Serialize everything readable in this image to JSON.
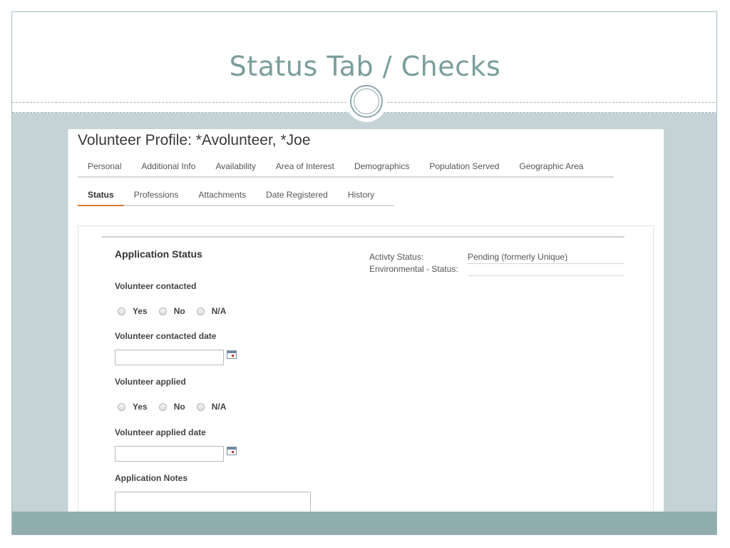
{
  "slide": {
    "title": "Status Tab / Checks"
  },
  "profile": {
    "title": "Volunteer Profile: *Avolunteer, *Joe"
  },
  "tabs_row1": [
    "Personal",
    "Additional Info",
    "Availability",
    "Area of Interest",
    "Demographics",
    "Population Served",
    "Geographic Area"
  ],
  "tabs_row2": [
    "Status",
    "Professions",
    "Attachments",
    "Date Registered",
    "History"
  ],
  "active_tab": "Status",
  "form": {
    "section_title": "Application Status",
    "volunteer_contacted_label": "Volunteer contacted",
    "contacted_options": [
      "Yes",
      "No",
      "N/A"
    ],
    "contacted_date_label": "Volunteer contacted date",
    "contacted_date_value": "",
    "volunteer_applied_label": "Volunteer applied",
    "applied_options": [
      "Yes",
      "No",
      "N/A"
    ],
    "applied_date_label": "Volunteer applied date",
    "applied_date_value": "",
    "notes_label": "Application Notes",
    "notes_value": ""
  },
  "status_info": {
    "activity_status_label": "Activty Status:",
    "activity_status_value": "Pending (formerly Unique)",
    "environmental_status_label": "Environmental - Status:",
    "environmental_status_value": ""
  },
  "colors": {
    "title": "#7a9e9b",
    "band": "#c5d3d6",
    "footer": "#8fadad",
    "active_tab_underline": "#e07a2e"
  }
}
